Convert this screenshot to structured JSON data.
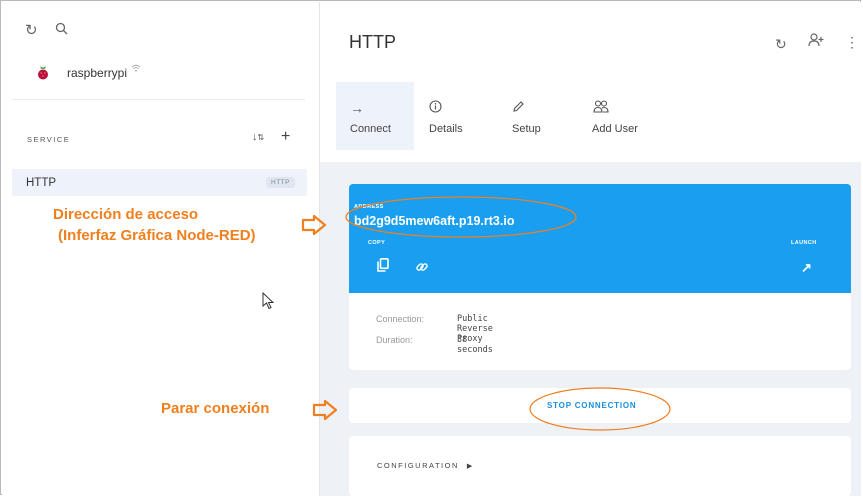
{
  "sidebar": {
    "device_name": "raspberrypi",
    "section_label": "SERVICE",
    "services": [
      {
        "label": "HTTP",
        "badge": "HTTP"
      }
    ]
  },
  "header": {
    "title": "HTTP"
  },
  "tabs": [
    {
      "label": "Connect",
      "icon": "arrow-right-icon",
      "active": true
    },
    {
      "label": "Details",
      "icon": "info-icon",
      "active": false
    },
    {
      "label": "Setup",
      "icon": "pencil-icon",
      "active": false
    },
    {
      "label": "Add User",
      "icon": "users-icon",
      "active": false
    }
  ],
  "connection": {
    "address_label": "ADDRESS",
    "address": "bd2g9d5mew6aft.p19.rt3.io",
    "copy_label": "COPY",
    "launch_label": "LAUNCH",
    "details": [
      {
        "label": "Connection:",
        "value": "Public Reverse Proxy"
      },
      {
        "label": "Duration:",
        "value": "38 seconds"
      }
    ]
  },
  "actions": {
    "stop_label": "STOP CONNECTION",
    "config_label": "CONFIGURATION"
  },
  "annotations": {
    "address_note_line1": "Dirección de acceso",
    "address_note_line2": "(Inferfaz Gráfica Node-RED)",
    "stop_note": "Parar conexión"
  },
  "colors": {
    "accent": "#1a9ff0",
    "annotation": "#f07f1e",
    "active_tab": "#eef3fb"
  }
}
